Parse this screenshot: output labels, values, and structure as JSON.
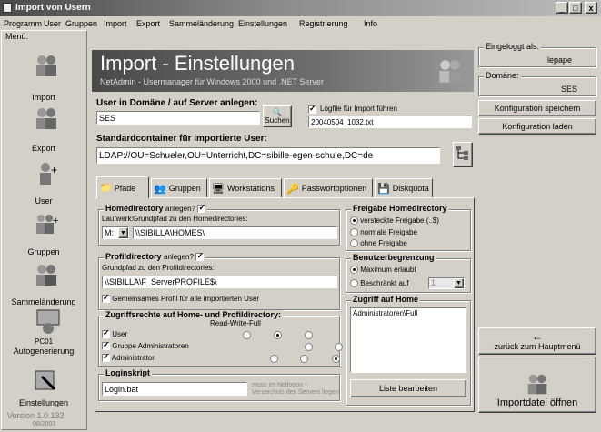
{
  "window": {
    "title": "Import von Usern",
    "min": "_",
    "max": "□",
    "close": "x"
  },
  "menubar": [
    "Programm",
    "User",
    "Gruppen",
    "Import",
    "Export",
    "Sammeländerung",
    "Einstellungen",
    "Registrierung",
    "Info"
  ],
  "sidebar": {
    "title": "Menü:",
    "items": [
      {
        "label": "Import",
        "icon": "users-import-icon"
      },
      {
        "label": "Export",
        "icon": "users-export-icon"
      },
      {
        "label": "User",
        "icon": "user-add-icon"
      },
      {
        "label": "Gruppen",
        "icon": "group-icon"
      },
      {
        "label": "Sammeländerung",
        "icon": "batch-change-icon"
      },
      {
        "label": "Autogenerierung",
        "icon": "autogen-icon",
        "badge": "PC01"
      },
      {
        "label": "Einstellungen",
        "icon": "settings-icon"
      }
    ],
    "version": "Version 1.0.132",
    "version_date": "08/2003"
  },
  "header": {
    "title": "Import - Einstellungen",
    "subtitle": "NetAdmin - Usermanager für Windows 2000 und .NET Server"
  },
  "right_panel": {
    "logged_in_label": "Eingeloggt als:",
    "logged_in_value": "lepape",
    "domain_label": "Domäne:",
    "domain_value": "SES",
    "save_config": "Konfiguration speichern",
    "load_config": "Konfiguration laden",
    "back_arrow": "←",
    "back_main": "zurück zum Hauptmenü",
    "import_open": "Importdatei öffnen"
  },
  "user_domain": {
    "label": "User in Domäne / auf Server anlegen:",
    "value": "SES",
    "search_btn": "Suchen",
    "logfile_label": "Logfile für Import führen",
    "logfile_value": "20040504_1032.txt"
  },
  "container": {
    "label": "Standardcontainer für importierte User:",
    "value": "LDAP://OU=Schueler,OU=Unterricht,DC=sibille-egen-schule,DC=de"
  },
  "tabs": [
    {
      "label": "Pfade",
      "icon": "folder-path-icon"
    },
    {
      "label": "Gruppen",
      "icon": "group-tab-icon"
    },
    {
      "label": "Workstations",
      "icon": "workstation-icon"
    },
    {
      "label": "Passwortoptionen",
      "icon": "password-icon"
    },
    {
      "label": "Diskquota",
      "icon": "disk-icon"
    }
  ],
  "homedir": {
    "title": "Homedirectory",
    "anlegen": "anlegen?",
    "drive_label": "Laufwerk:",
    "path_label": "Grundpfad zu den Homedirectories:",
    "drive_value": "M:",
    "path_value": "\\\\SIBILLA\\HOMES\\"
  },
  "freigabe": {
    "title": "Freigabe Homedirectory",
    "options": [
      "versteckte Freigabe (..$)",
      "normale Freigabe",
      "ohne Freigabe"
    ]
  },
  "profil": {
    "title": "Profildirectory",
    "anlegen": "anlegen?",
    "path_label": "Grundpfad zu den Profildirectories:",
    "path_value": "\\\\SIBILLA\\F_ServerPROFILE$\\",
    "shared_profile": "Gemeinsames Profil für alle importierten User"
  },
  "limit": {
    "title": "Benutzerbegrenzung",
    "max": "Maximum erlaubt",
    "limited": "Beschränkt auf",
    "limited_value": "1"
  },
  "rights": {
    "title": "Zugriffsrechte auf Home- und Profildirectory:",
    "cols": "Read-Write-Full",
    "rows": [
      {
        "label": "User",
        "checked": true,
        "selected": 1
      },
      {
        "label": "Gruppe Administratoren",
        "checked": true,
        "selected": 2
      },
      {
        "label": "Administrator",
        "checked": true,
        "selected": 2
      }
    ]
  },
  "home_access": {
    "title": "Zugriff auf Home",
    "entries": [
      "Administratoren\\Full"
    ],
    "edit_btn": "Liste bearbeiten"
  },
  "login": {
    "title": "Loginskript",
    "value": "Login.bat",
    "hint_line1": "muss im Netlogon -",
    "hint_line2": "Verzeichnis des Servers liegen"
  }
}
